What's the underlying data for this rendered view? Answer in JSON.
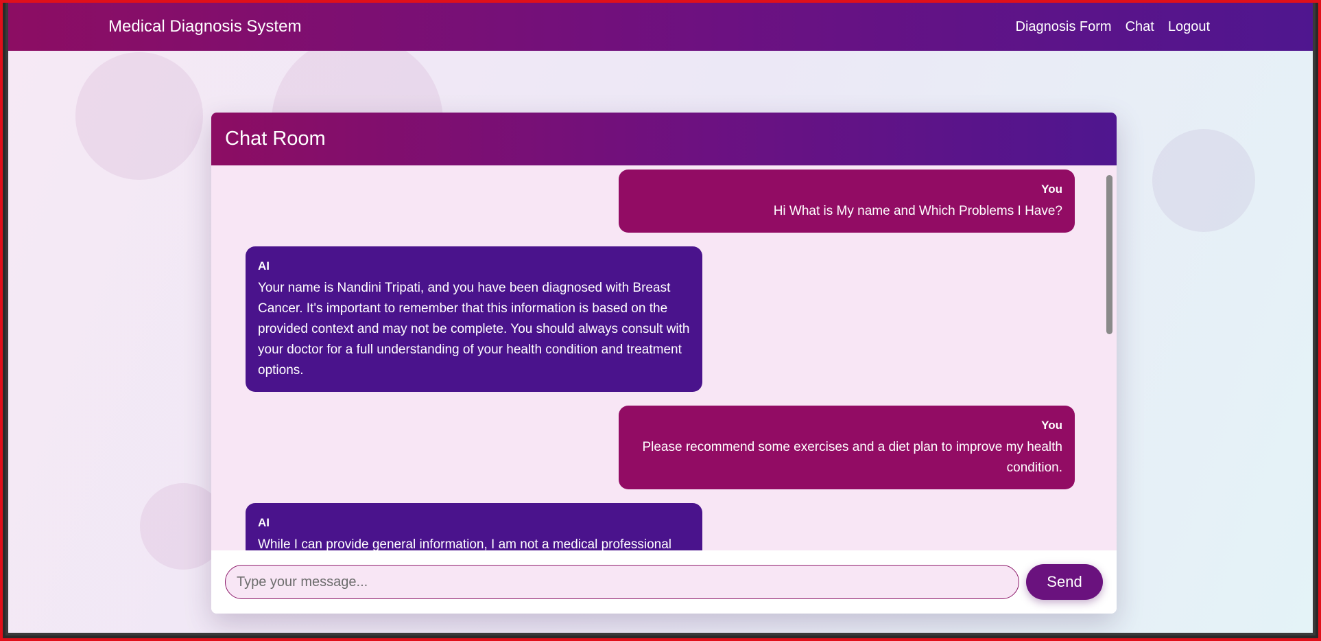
{
  "navbar": {
    "brand": "Medical Diagnosis System",
    "links": [
      "Diagnosis Form",
      "Chat",
      "Logout"
    ]
  },
  "chat": {
    "title": "Chat Room",
    "messages": [
      {
        "sender": "You",
        "text": "Hi What is My name and Which Problems I Have?"
      },
      {
        "sender": "AI",
        "text": "Your name is Nandini Tripati, and you have been diagnosed with Breast Cancer. It's important to remember that this information is based on the provided context and may not be complete. You should always consult with your doctor for a full understanding of your health condition and treatment options."
      },
      {
        "sender": "You",
        "text": "Please recommend some exercises and a diet plan to improve my health condition."
      },
      {
        "sender": "AI",
        "text": "While I can provide general information, I am not a medical professional and cannot give specific medical advice. It's important to"
      }
    ],
    "input_placeholder": "Type your message...",
    "send_label": "Send"
  },
  "colors": {
    "header_start": "#8c0d63",
    "header_end": "#4f168f",
    "user_bubble": "#920c64",
    "ai_bubble": "#4a138c",
    "chat_bg": "#f8e6f5"
  }
}
